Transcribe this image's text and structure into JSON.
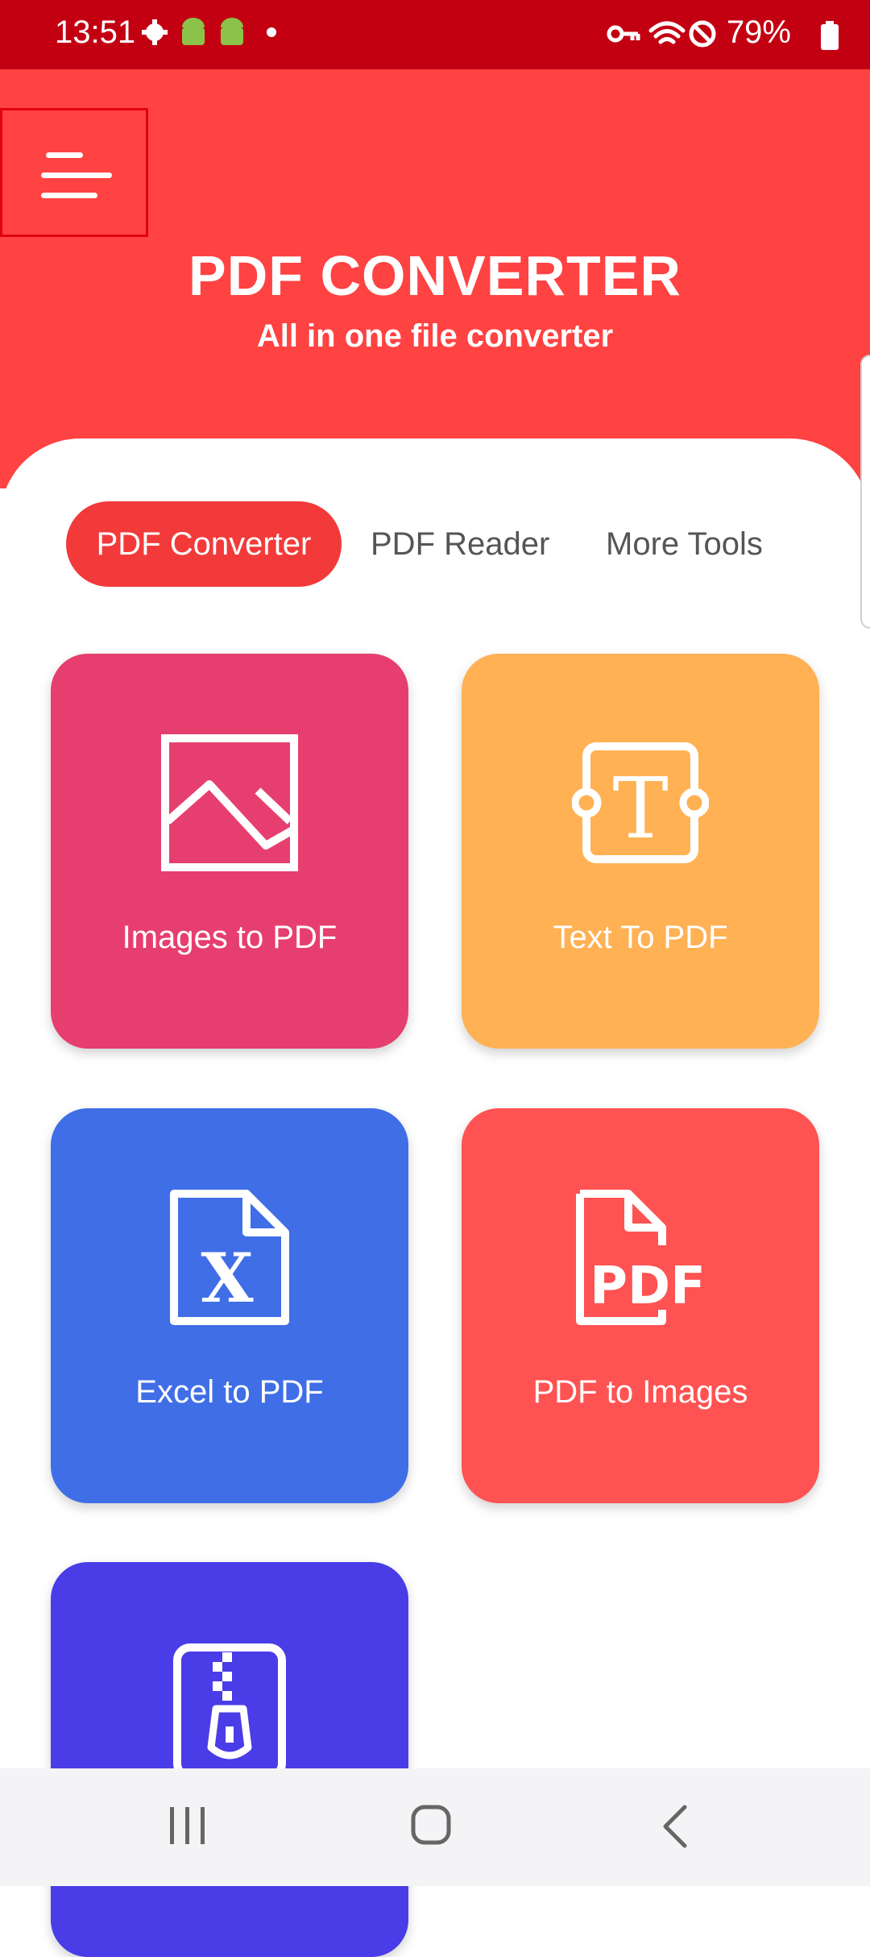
{
  "status_bar": {
    "time": "13:51",
    "battery": "79%",
    "icons_left": [
      "settings-gear-icon",
      "android-icon",
      "android-icon",
      "dot-icon"
    ],
    "icons_right": [
      "key-icon",
      "wifi-icon",
      "do-not-disturb-icon",
      "battery-icon"
    ]
  },
  "header": {
    "title": "PDF CONVERTER",
    "subtitle": "All in one file converter",
    "background_color": "#ff4242"
  },
  "tabs": [
    {
      "label": "PDF Converter",
      "selected": true
    },
    {
      "label": "PDF Reader",
      "selected": false
    },
    {
      "label": "More Tools",
      "selected": false
    }
  ],
  "tools": [
    {
      "label": "Images to PDF",
      "icon": "image-icon",
      "color": "#e63f6f"
    },
    {
      "label": "Text To PDF",
      "icon": "text-icon",
      "color": "#ffb154"
    },
    {
      "label": "Excel to PDF",
      "icon": "excel-file-icon",
      "color": "#3f6ee6"
    },
    {
      "label": "PDF to Images",
      "icon": "pdf-file-icon",
      "color": "#ff5252"
    },
    {
      "label": "",
      "icon": "zip-file-icon",
      "color": "#4a3ce6"
    }
  ],
  "nav_bar": {
    "buttons": [
      "recent-apps-icon",
      "home-icon",
      "back-icon"
    ]
  }
}
